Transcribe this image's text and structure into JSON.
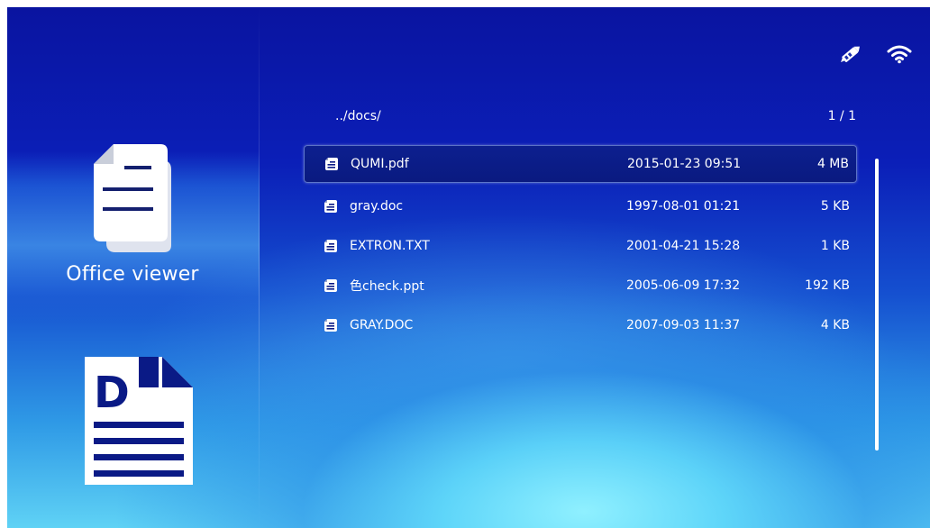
{
  "app": {
    "title": "Office viewer"
  },
  "status": {
    "icons": [
      "usb-edit-icon",
      "wifi-icon"
    ]
  },
  "browser": {
    "path": "../docs/",
    "page": "1 / 1"
  },
  "files": [
    {
      "name": "QUMI.pdf",
      "date": "2015-01-23 09:51",
      "size": "4 MB",
      "selected": true
    },
    {
      "name": "gray.doc",
      "date": "1997-08-01 01:21",
      "size": "5 KB",
      "selected": false
    },
    {
      "name": "EXTRON.TXT",
      "date": "2001-04-21 15:28",
      "size": "1 KB",
      "selected": false
    },
    {
      "name": "色check.ppt",
      "date": "2005-06-09 17:32",
      "size": "192 KB",
      "selected": false
    },
    {
      "name": "GRAY.DOC",
      "date": "2007-09-03 11:37",
      "size": "4 KB",
      "selected": false
    }
  ],
  "doc_type_icon": {
    "letter": "D"
  },
  "colors": {
    "background_top": "#0a14a0",
    "background_bottom": "#5fd2f5",
    "selected_row": "#0c1f8f",
    "icon_dark": "#0b1880",
    "text": "#ffffff"
  }
}
